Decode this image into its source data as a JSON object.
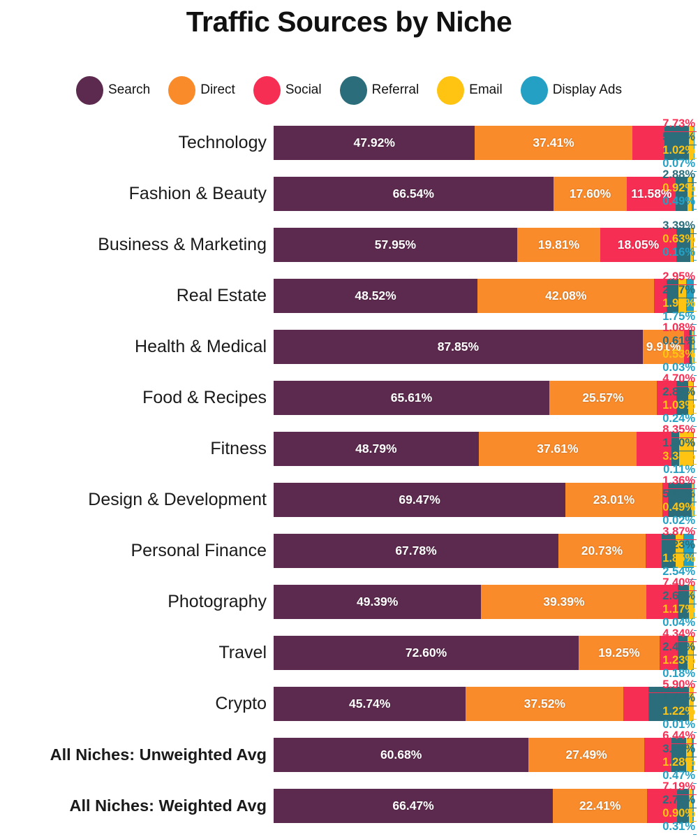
{
  "title": "Traffic Sources by Niche",
  "legend": {
    "position": "top",
    "items": [
      {
        "label": "Search",
        "color": "#5c2a4e"
      },
      {
        "label": "Direct",
        "color": "#f98b2b"
      },
      {
        "label": "Social",
        "color": "#f72e54"
      },
      {
        "label": "Referral",
        "color": "#2b6d7a"
      },
      {
        "label": "Email",
        "color": "#ffc412"
      },
      {
        "label": "Display Ads",
        "color": "#24a0c4"
      }
    ]
  },
  "chart_data": {
    "type": "bar",
    "orientation": "horizontal",
    "stacked": true,
    "normalized": true,
    "title": "Traffic Sources by Niche",
    "xlabel": "",
    "ylabel": "",
    "xlim": [
      0,
      100
    ],
    "grid": false,
    "legend_position": "top",
    "value_suffix": "%",
    "categories": [
      "Technology",
      "Fashion & Beauty",
      "Business & Marketing",
      "Real Estate",
      "Health & Medical",
      "Food & Recipes",
      "Fitness",
      "Design & Development",
      "Personal Finance",
      "Photography",
      "Travel",
      "Crypto",
      "All Niches: Unweighted Avg",
      "All Niches: Weighted Avg"
    ],
    "emphasized_categories": [
      "All Niches: Unweighted Avg",
      "All Niches: Weighted Avg"
    ],
    "series": [
      {
        "name": "Search",
        "color": "#5c2a4e",
        "values": [
          47.92,
          66.54,
          57.95,
          48.52,
          87.85,
          65.61,
          48.79,
          69.47,
          67.78,
          49.39,
          72.6,
          45.74,
          60.68,
          66.47
        ]
      },
      {
        "name": "Direct",
        "color": "#f98b2b",
        "values": [
          37.41,
          17.6,
          19.81,
          42.08,
          9.91,
          25.57,
          37.61,
          23.01,
          20.73,
          39.39,
          19.25,
          37.52,
          27.49,
          22.41
        ]
      },
      {
        "name": "Social",
        "color": "#f72e54",
        "values": [
          7.73,
          11.58,
          18.05,
          2.95,
          1.08,
          4.7,
          8.35,
          1.36,
          3.87,
          7.4,
          4.34,
          5.9,
          6.44,
          7.19
        ]
      },
      {
        "name": "Referral",
        "color": "#2b6d7a",
        "values": [
          5.85,
          2.88,
          3.39,
          2.77,
          0.61,
          2.86,
          1.8,
          5.65,
          3.23,
          2.6,
          2.4,
          9.6,
          3.64,
          2.72
        ]
      },
      {
        "name": "Email",
        "color": "#ffc412",
        "values": [
          1.02,
          0.92,
          0.63,
          1.92,
          0.53,
          1.03,
          3.34,
          0.49,
          1.85,
          1.17,
          1.23,
          1.22,
          1.28,
          0.9
        ]
      },
      {
        "name": "Display Ads",
        "color": "#24a0c4",
        "values": [
          0.07,
          0.49,
          0.16,
          1.75,
          0.03,
          0.24,
          0.11,
          0.02,
          2.54,
          0.04,
          0.18,
          0.01,
          0.47,
          0.31
        ]
      }
    ],
    "rows": [
      {
        "label": "Technology",
        "values": [
          47.92,
          37.41,
          7.73,
          5.85,
          1.02,
          0.07
        ],
        "inline": [
          true,
          true,
          false,
          false,
          false,
          false
        ]
      },
      {
        "label": "Fashion & Beauty",
        "values": [
          66.54,
          17.6,
          11.58,
          2.88,
          0.92,
          0.49
        ],
        "inline": [
          true,
          true,
          true,
          false,
          false,
          false
        ]
      },
      {
        "label": "Business & Marketing",
        "values": [
          57.95,
          19.81,
          18.05,
          3.39,
          0.63,
          0.16
        ],
        "inline": [
          true,
          true,
          true,
          false,
          false,
          false
        ]
      },
      {
        "label": "Real Estate",
        "values": [
          48.52,
          42.08,
          2.95,
          2.77,
          1.92,
          1.75
        ],
        "inline": [
          true,
          true,
          false,
          false,
          false,
          false
        ]
      },
      {
        "label": "Health & Medical",
        "values": [
          87.85,
          9.91,
          1.08,
          0.61,
          0.53,
          0.03
        ],
        "inline": [
          true,
          true,
          false,
          false,
          false,
          false
        ]
      },
      {
        "label": "Food & Recipes",
        "values": [
          65.61,
          25.57,
          4.7,
          2.86,
          1.03,
          0.24
        ],
        "inline": [
          true,
          true,
          false,
          false,
          false,
          false
        ]
      },
      {
        "label": "Fitness",
        "values": [
          48.79,
          37.61,
          8.35,
          1.8,
          3.34,
          0.11
        ],
        "inline": [
          true,
          true,
          false,
          false,
          false,
          false
        ]
      },
      {
        "label": "Design & Development",
        "values": [
          69.47,
          23.01,
          1.36,
          5.65,
          0.49,
          0.02
        ],
        "inline": [
          true,
          true,
          false,
          false,
          false,
          false
        ]
      },
      {
        "label": "Personal Finance",
        "values": [
          67.78,
          20.73,
          3.87,
          3.23,
          1.85,
          2.54
        ],
        "inline": [
          true,
          true,
          false,
          false,
          false,
          false
        ]
      },
      {
        "label": "Photography",
        "values": [
          49.39,
          39.39,
          7.4,
          2.6,
          1.17,
          0.04
        ],
        "inline": [
          true,
          true,
          false,
          false,
          false,
          false
        ]
      },
      {
        "label": "Travel",
        "values": [
          72.6,
          19.25,
          4.34,
          2.4,
          1.23,
          0.18
        ],
        "inline": [
          true,
          true,
          false,
          false,
          false,
          false
        ]
      },
      {
        "label": "Crypto",
        "values": [
          45.74,
          37.52,
          5.9,
          9.6,
          1.22,
          0.01
        ],
        "inline": [
          true,
          true,
          false,
          false,
          false,
          false
        ]
      },
      {
        "label": "All Niches: Unweighted Avg",
        "values": [
          60.68,
          27.49,
          6.44,
          3.64,
          1.28,
          0.47
        ],
        "inline": [
          true,
          true,
          false,
          false,
          false,
          false
        ]
      },
      {
        "label": "All Niches: Weighted Avg",
        "values": [
          66.47,
          22.41,
          7.19,
          2.72,
          0.9,
          0.31
        ],
        "inline": [
          true,
          true,
          false,
          false,
          false,
          false
        ]
      }
    ]
  }
}
